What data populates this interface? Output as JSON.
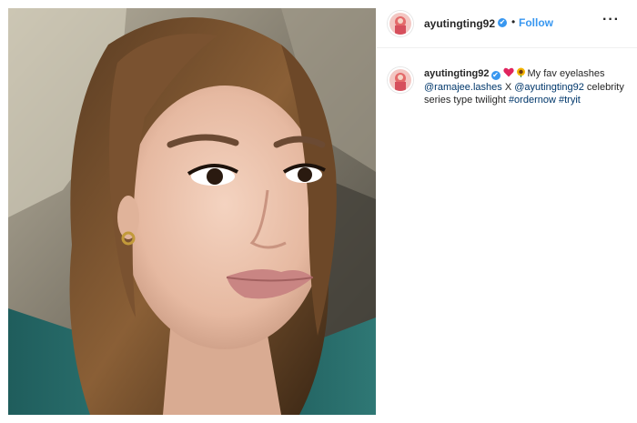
{
  "header": {
    "username": "ayutingting92",
    "verified_mark": "✔",
    "separator": "•",
    "follow_label": "Follow",
    "more_label": "···"
  },
  "caption": {
    "username": "ayutingting92",
    "verified_mark": "✔",
    "emojis": [
      "heart-icon",
      "sunflower-icon"
    ],
    "text_before_mention1": "My fav eyelashes ",
    "mention1": "@ramajee.lashes",
    "text_after_mention1": " X ",
    "mention2": "@ayutingting92",
    "text_after_mention2": " celebrity series type twilight ",
    "hashtag1": "#ordernow",
    "hashtag2": "#tryit"
  },
  "colors": {
    "accent_blue": "#3897f0",
    "link_dark_blue": "#00376b",
    "text": "#262626",
    "divider": "#efefef"
  }
}
